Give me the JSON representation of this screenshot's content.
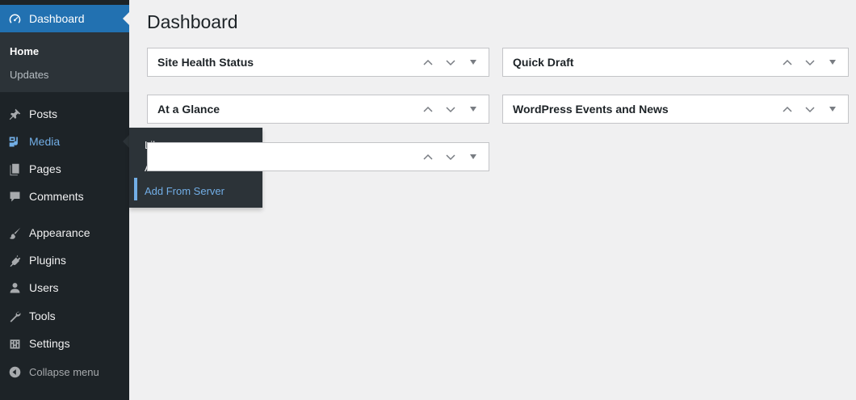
{
  "page": {
    "title": "Dashboard"
  },
  "sidebar": {
    "dashboard": {
      "label": "Dashboard",
      "icon": "dashboard-gauge-icon"
    },
    "dashboard_sub": [
      {
        "label": "Home",
        "current": true
      },
      {
        "label": "Updates",
        "current": false
      }
    ],
    "items": [
      {
        "label": "Posts",
        "icon": "pin-icon"
      },
      {
        "label": "Media",
        "icon": "media-icon"
      },
      {
        "label": "Pages",
        "icon": "page-icon"
      },
      {
        "label": "Comments",
        "icon": "comment-icon"
      },
      {
        "label": "Appearance",
        "icon": "brush-icon"
      },
      {
        "label": "Plugins",
        "icon": "plug-icon"
      },
      {
        "label": "Users",
        "icon": "user-icon"
      },
      {
        "label": "Tools",
        "icon": "wrench-icon"
      },
      {
        "label": "Settings",
        "icon": "settings-sliders-icon"
      }
    ],
    "collapse": {
      "label": "Collapse menu",
      "icon": "collapse-arrow-icon"
    }
  },
  "media_flyout": {
    "items": [
      {
        "label": "Library"
      },
      {
        "label": "Add New"
      },
      {
        "label": "Add From Server",
        "active": true
      }
    ]
  },
  "widgets": {
    "site_health": {
      "title": "Site Health Status"
    },
    "quick_draft": {
      "title": "Quick Draft"
    },
    "at_a_glance": {
      "title": "At a Glance"
    },
    "events_news": {
      "title": "WordPress Events and News"
    },
    "activity": {
      "title": ""
    }
  },
  "colors": {
    "sidebar_bg": "#1d2327",
    "accent": "#2271b1",
    "highlight": "#72aee6",
    "page_bg": "#f0f0f1"
  }
}
